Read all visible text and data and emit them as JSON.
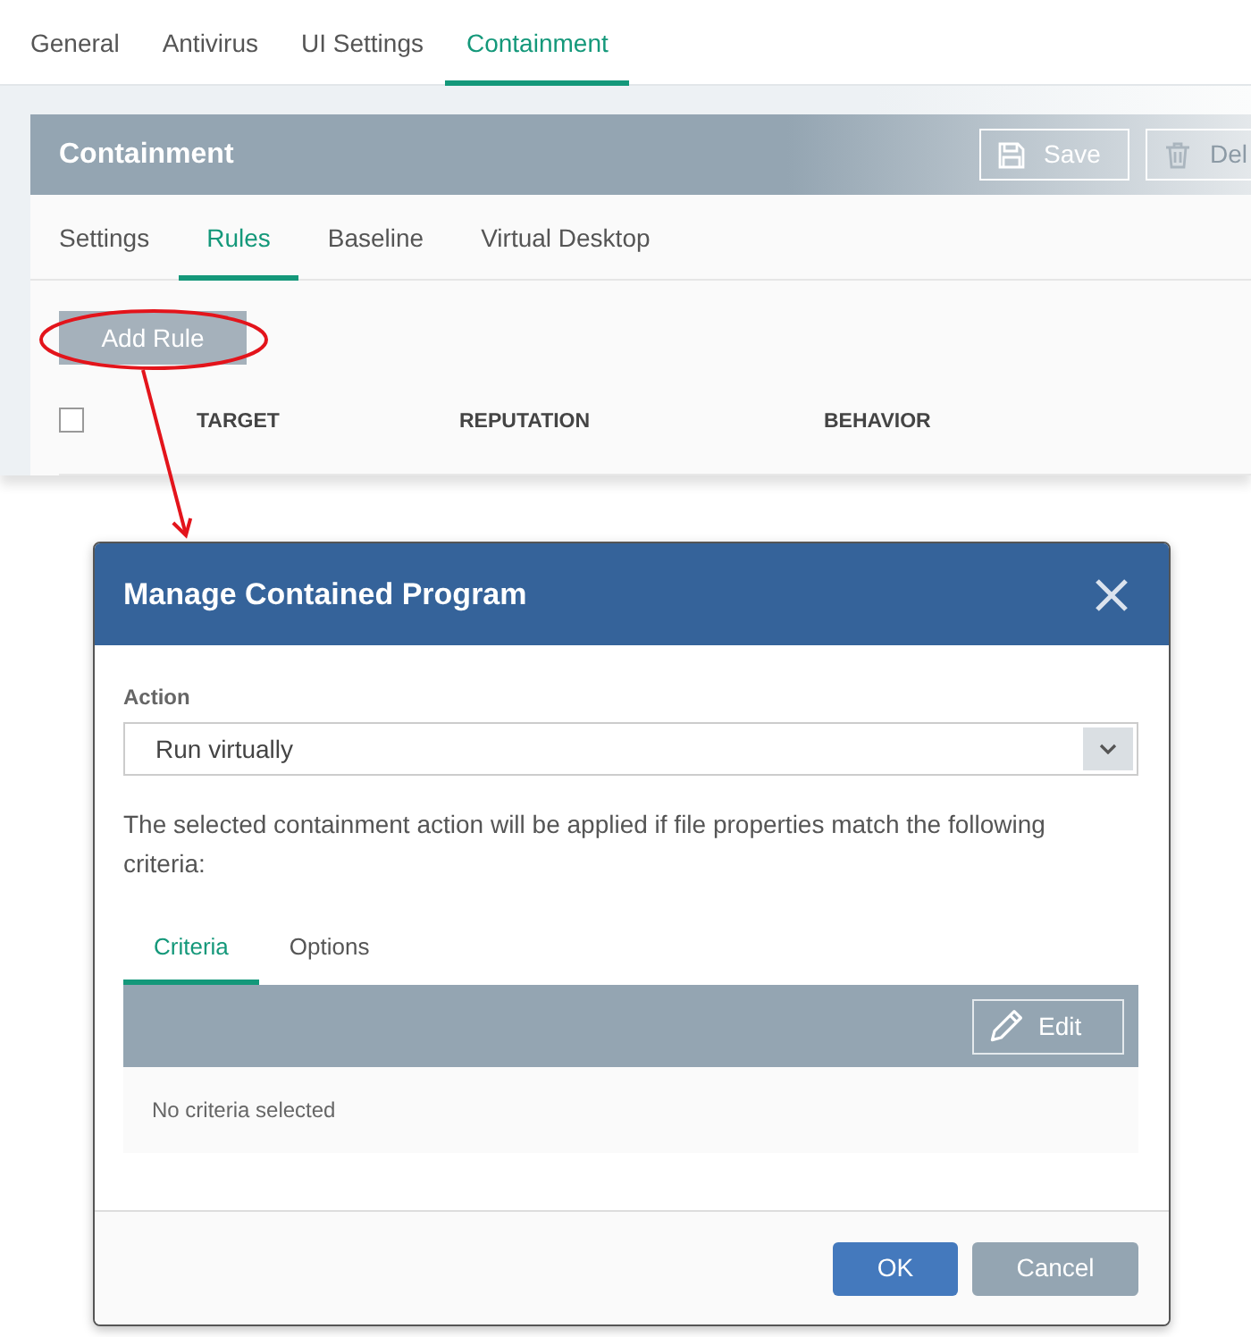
{
  "top_tabs": [
    {
      "label": "General",
      "selected": false
    },
    {
      "label": "Antivirus",
      "selected": false
    },
    {
      "label": "UI Settings",
      "selected": false
    },
    {
      "label": "Containment",
      "selected": true
    }
  ],
  "panel": {
    "title": "Containment",
    "buttons": [
      {
        "label": "Save",
        "kind": "save"
      },
      {
        "label": "Del",
        "kind": "delete"
      }
    ],
    "tabs": [
      {
        "label": "Settings",
        "selected": false
      },
      {
        "label": "Rules",
        "selected": true
      },
      {
        "label": "Baseline",
        "selected": false
      },
      {
        "label": "Virtual Desktop",
        "selected": false
      }
    ],
    "add_button": "Add Rule",
    "table": {
      "select_all": {
        "checked": false
      },
      "columns": [
        "TARGET",
        "REPUTATION",
        "BEHAVIOR"
      ]
    }
  },
  "dialog": {
    "title": "Manage Contained Program",
    "action_label": "Action",
    "action_value": "Run virtually",
    "description": "The selected containment action will be applied if file properties match the following criteria:",
    "tabs": [
      {
        "label": "Criteria",
        "selected": true
      },
      {
        "label": "Options",
        "selected": false
      }
    ],
    "edit_button": "Edit",
    "empty_text": "No criteria selected",
    "buttons": [
      {
        "label": "OK",
        "kind": "primary"
      },
      {
        "label": "Cancel",
        "kind": "secondary"
      }
    ]
  }
}
